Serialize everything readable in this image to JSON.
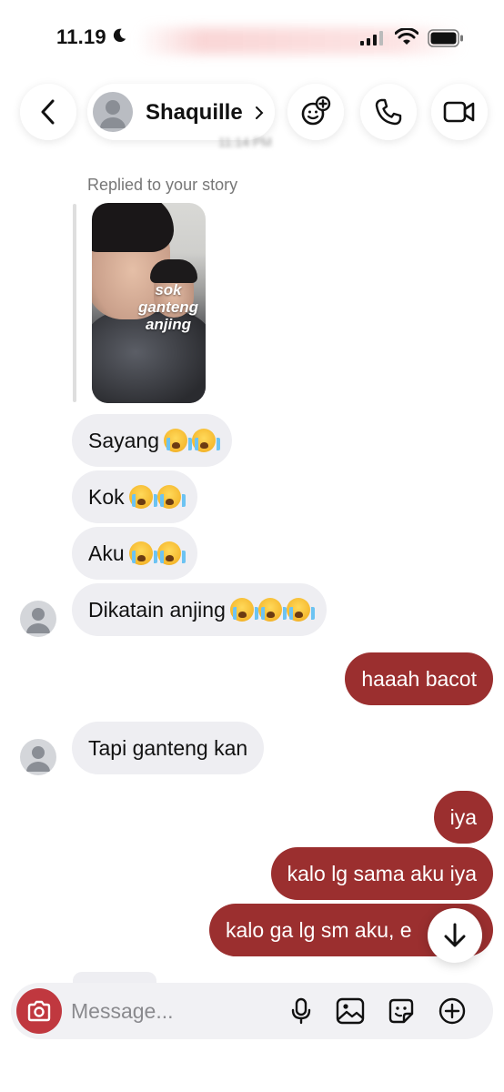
{
  "status_bar": {
    "time": "11.19"
  },
  "header": {
    "contact_name": "Shaquille",
    "blurred_time": "11:14 PM"
  },
  "story_reply": {
    "label": "Replied to your story",
    "story_text": "sok ganteng anjing"
  },
  "messages": [
    {
      "dir": "in",
      "text": "Sayang",
      "emoji_count": 2
    },
    {
      "dir": "in",
      "text": "Kok",
      "emoji_count": 2
    },
    {
      "dir": "in",
      "text": "Aku",
      "emoji_count": 2
    },
    {
      "dir": "in",
      "text": "Dikatain anjing",
      "emoji_count": 3
    },
    {
      "dir": "out",
      "text": "haaah bacot"
    },
    {
      "dir": "in",
      "text": "Tapi ganteng kan"
    },
    {
      "dir": "out",
      "text": "iya"
    },
    {
      "dir": "out",
      "text": "kalo lg sama aku iya"
    },
    {
      "dir": "out",
      "text": "kalo ga lg sm aku, e"
    }
  ],
  "composer": {
    "placeholder": "Message..."
  },
  "colors": {
    "outgoing_bubble": "#9b2f2f",
    "incoming_bubble": "#eeeef2",
    "camera_button": "#c0383f"
  }
}
